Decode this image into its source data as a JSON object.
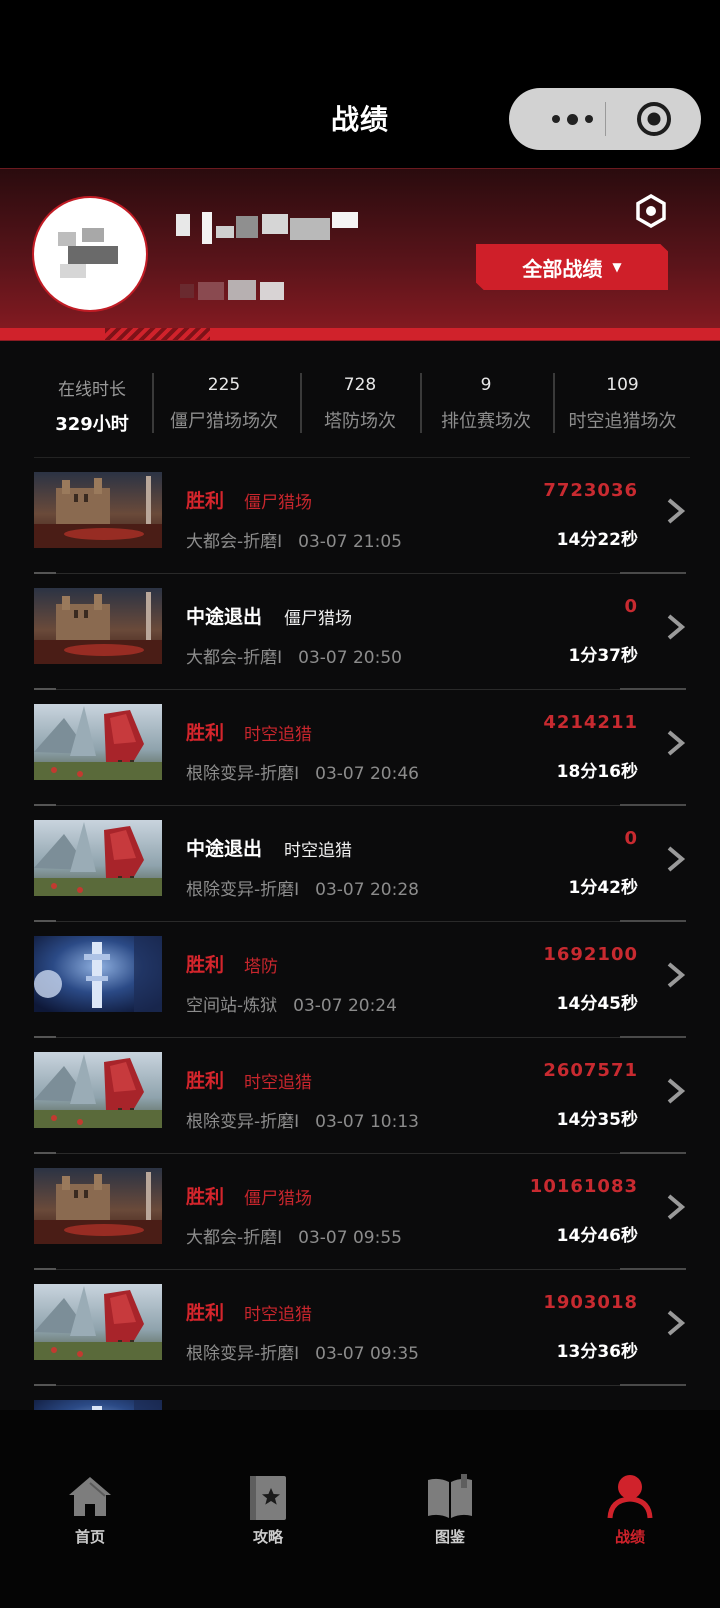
{
  "header": {
    "title": "战绩"
  },
  "profile": {
    "filter_label": "全部战绩"
  },
  "stats": {
    "online_label": "在线时长",
    "online_value": "329小时",
    "items": [
      {
        "value": "225",
        "label": "僵尸猎场场次"
      },
      {
        "value": "728",
        "label": "塔防场次"
      },
      {
        "value": "9",
        "label": "排位赛场次"
      },
      {
        "value": "109",
        "label": "时空追猎场次"
      }
    ]
  },
  "records": [
    {
      "result": "胜利",
      "result_type": "win",
      "mode": "僵尸猎场",
      "map": "大都会-折磨I",
      "time": "03-07 21:05",
      "score": "7723036",
      "duration": "14分22秒",
      "thumb": "castle"
    },
    {
      "result": "中途退出",
      "result_type": "quit",
      "mode": "僵尸猎场",
      "map": "大都会-折磨I",
      "time": "03-07 20:50",
      "score": "0",
      "duration": "1分37秒",
      "thumb": "castle"
    },
    {
      "result": "胜利",
      "result_type": "win",
      "mode": "时空追猎",
      "map": "根除变异-折磨I",
      "time": "03-07 20:46",
      "score": "4214211",
      "duration": "18分16秒",
      "thumb": "mountain"
    },
    {
      "result": "中途退出",
      "result_type": "quit",
      "mode": "时空追猎",
      "map": "根除变异-折磨I",
      "time": "03-07 20:28",
      "score": "0",
      "duration": "1分42秒",
      "thumb": "mountain"
    },
    {
      "result": "胜利",
      "result_type": "win",
      "mode": "塔防",
      "map": "空间站-炼狱",
      "time": "03-07 20:24",
      "score": "1692100",
      "duration": "14分45秒",
      "thumb": "space"
    },
    {
      "result": "胜利",
      "result_type": "win",
      "mode": "时空追猎",
      "map": "根除变异-折磨I",
      "time": "03-07 10:13",
      "score": "2607571",
      "duration": "14分35秒",
      "thumb": "mountain"
    },
    {
      "result": "胜利",
      "result_type": "win",
      "mode": "僵尸猎场",
      "map": "大都会-折磨I",
      "time": "03-07 09:55",
      "score": "10161083",
      "duration": "14分46秒",
      "thumb": "castle"
    },
    {
      "result": "胜利",
      "result_type": "win",
      "mode": "时空追猎",
      "map": "根除变异-折磨I",
      "time": "03-07 09:35",
      "score": "1903018",
      "duration": "13分36秒",
      "thumb": "mountain"
    },
    {
      "result": "",
      "result_type": "win",
      "mode": "",
      "map": "",
      "time": "",
      "score": "",
      "duration": "",
      "thumb": "space"
    }
  ],
  "tabbar": {
    "items": [
      {
        "label": "首页",
        "icon": "home-icon"
      },
      {
        "label": "攻略",
        "icon": "guide-book-icon"
      },
      {
        "label": "图鉴",
        "icon": "open-book-icon"
      },
      {
        "label": "战绩",
        "icon": "user-icon"
      }
    ],
    "active_index": 3
  },
  "colors": {
    "accent": "#d0222b",
    "background": "#0b0b0c"
  }
}
